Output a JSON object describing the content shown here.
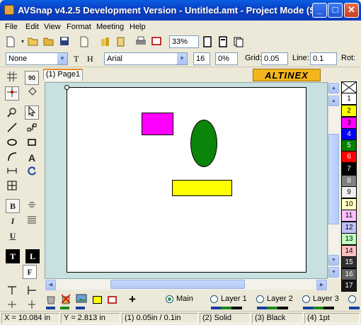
{
  "window": {
    "title": "AVSnap v4.2.5 Development Version - Untitled.amt - Project Mode (S...",
    "minimize": "_",
    "maximize": "□",
    "close": "✕"
  },
  "menu": [
    "File",
    "Edit",
    "View",
    "Format",
    "Meeting",
    "Help"
  ],
  "toolbar": {
    "zoom": "33%",
    "brand": "ALTINEX"
  },
  "format_bar": {
    "style_value": "None",
    "t_label": "T",
    "h_label": "H",
    "font_value": "Arial",
    "font_size": "16",
    "percent": "0%",
    "grid_label": "Grid:",
    "grid_value": "0.05",
    "line_label": "Line:",
    "line_value": "0.1",
    "rot_label": "Rot:"
  },
  "left_tools": {
    "b_label": "B",
    "i_label": "I",
    "u_label": "U",
    "t_label": "T",
    "l_label": "L",
    "f_label": "F",
    "a_label": "A",
    "deg_label": "90"
  },
  "tabs": [
    {
      "label": "(1) Page1"
    }
  ],
  "canvas": {
    "shapes": [
      {
        "type": "rectangle",
        "color": "#ff00ff"
      },
      {
        "type": "ellipse",
        "color": "#0a850a"
      },
      {
        "type": "rectangle",
        "color": "#ffff00"
      }
    ]
  },
  "palette": [
    {
      "label": "",
      "color": "#ffffff"
    },
    {
      "label": "1",
      "color": "#ffffff"
    },
    {
      "label": "2",
      "color": "#ffff00"
    },
    {
      "label": "3",
      "color": "#ff00ff"
    },
    {
      "label": "4",
      "color": "#0000ff"
    },
    {
      "label": "5",
      "color": "#008000"
    },
    {
      "label": "6",
      "color": "#ff0000"
    },
    {
      "label": "7",
      "color": "#000000"
    },
    {
      "label": "8",
      "color": "#808080"
    },
    {
      "label": "9",
      "color": "#f0f0f0"
    },
    {
      "label": "10",
      "color": "#ffffc0"
    },
    {
      "label": "11",
      "color": "#ffc0ff"
    },
    {
      "label": "12",
      "color": "#c0c0ff"
    },
    {
      "label": "13",
      "color": "#c0ffc0"
    },
    {
      "label": "14",
      "color": "#ffc0c0"
    },
    {
      "label": "15",
      "color": "#303030"
    },
    {
      "label": "16",
      "color": "#606060"
    },
    {
      "label": "17",
      "color": "#181818"
    }
  ],
  "layers": {
    "main": "Main",
    "layer1": "Layer 1",
    "layer2": "Layer 2",
    "layer3": "Layer 3"
  },
  "status": {
    "x": "X = 10.084 in",
    "y": "Y = 2.813 in",
    "size": "(1) 0.05in / 0.1in",
    "line_style": "(2) Solid",
    "color": "(3) Black",
    "width": "(4) 1pt"
  }
}
